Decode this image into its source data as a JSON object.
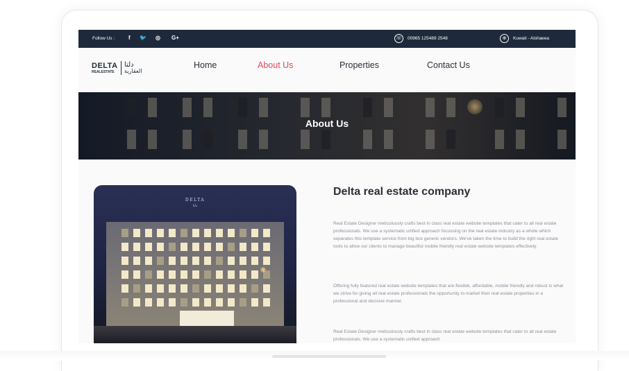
{
  "topbar": {
    "follow_label": "Follow Us :",
    "social": [
      {
        "icon": "facebook-icon",
        "glyph": "f"
      },
      {
        "icon": "twitter-icon",
        "glyph": "🐦"
      },
      {
        "icon": "instagram-icon",
        "glyph": "◎"
      },
      {
        "icon": "google-plus-icon",
        "glyph": "G+"
      }
    ],
    "phone_icon": "☏",
    "phone": "00965 125489 2548",
    "location_icon": "⊕",
    "location": "Kuwait - Alshaeea"
  },
  "logo": {
    "main": "DELTA",
    "sub": "REALESTATE",
    "arabic_top": "دلتا",
    "arabic_bottom": "العقارية"
  },
  "nav": {
    "items": [
      {
        "label": "Home",
        "active": false
      },
      {
        "label": "About Us",
        "active": true
      },
      {
        "label": "Properties",
        "active": false
      },
      {
        "label": "Contact Us",
        "active": false
      }
    ]
  },
  "hero": {
    "title": "About Us"
  },
  "about": {
    "photo_brand": "DELTA",
    "photo_brand_arabic": "دلتا",
    "heading": "Delta real estate company",
    "paragraphs": [
      "Real Estate Designer meticulously crafts best in class real estate website templates that cater to all real estate professionals. We use a systematic unified approach focussing on the real estate industry as a whole which separates this template service from big box generic vendors. We've taken the time to build the right real estate tools to allow our clients to manage beautiful mobile friendly real estate website templates effectively.",
      "Offering fully featured real estate website templates that are flexible, affordable, mobile friendly and robust is what we strive for giving all real estate professionals the opportunity to market their real estate properties in a professional and decisive manner.",
      "Real Estate Designer meticulously crafts best in class real estate website templates that cater to all real estate professionals. We use a systematic unified approach"
    ]
  },
  "colors": {
    "topbar": "#1e2a3c",
    "accent": "#e2485b",
    "heading": "#2b2f38",
    "body_text": "#8b8f99"
  }
}
